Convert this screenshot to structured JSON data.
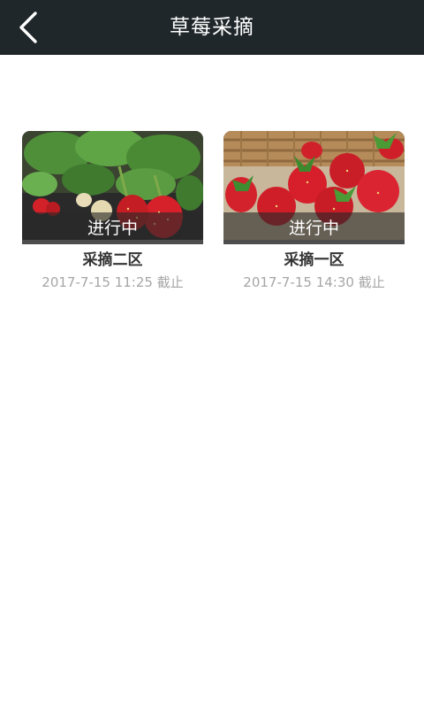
{
  "header": {
    "title": "草莓采摘",
    "back_icon": "chevron-left-icon",
    "background": "#20272b"
  },
  "cards": [
    {
      "status": "进行中",
      "name": "采摘二区",
      "deadline": "2017-7-15 11:25 截止",
      "image": "strawberry-plant-photo"
    },
    {
      "status": "进行中",
      "name": "采摘一区",
      "deadline": "2017-7-15 14:30 截止",
      "image": "strawberry-basket-photo"
    }
  ]
}
